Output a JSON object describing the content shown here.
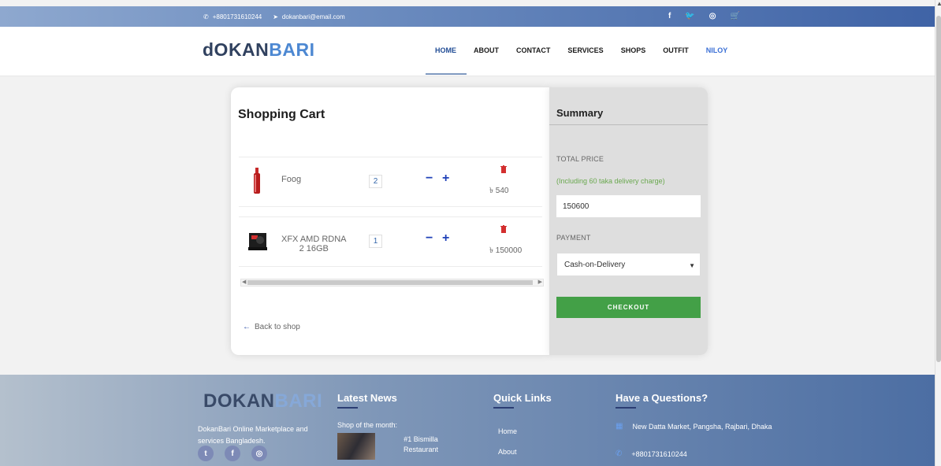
{
  "topbar": {
    "phone": "+8801731610244",
    "email": "dokanbari@email.com",
    "social_icons": [
      "facebook-icon",
      "twitter-icon",
      "instagram-icon",
      "cart-icon"
    ]
  },
  "navbar": {
    "logo_left": "dOKAN",
    "logo_right": "BARI",
    "menu": [
      "HOME",
      "ABOUT",
      "CONTACT",
      "SERVICES",
      "SHOPS",
      "OUTFIT",
      "NILOY"
    ],
    "active_menu": "HOME"
  },
  "cart": {
    "title": "Shopping Cart",
    "items": [
      {
        "name": "Foog",
        "qty": "2",
        "price": "৳ 540"
      },
      {
        "name_line1": "XFX AMD RDNA",
        "name_line2": "2 16GB",
        "qty": "1",
        "price": "৳ 150000"
      }
    ],
    "minus_label": "−",
    "plus_label": "+",
    "back_label": "Back to shop"
  },
  "summary": {
    "title": "Summary",
    "total_label": "TOTAL PRICE",
    "note": "(Including 60 taka delivery charge)",
    "total_value": "150600",
    "payment_label": "PAYMENT",
    "payment_selected": "Cash-on-Delivery",
    "checkout_label": "CHECKOUT"
  },
  "footer": {
    "logo_left": "DOKAN",
    "logo_right": "BARI",
    "desc": "DokanBari Online Marketplace and services Bangladesh.",
    "latest_news_title": "Latest News",
    "latest_news_sub": "Shop of the month:",
    "latest_news_item": "#1 Bismilla Restaurant",
    "quick_links_title": "Quick Links",
    "quick_links": [
      "Home",
      "About"
    ],
    "questions_title": "Have a Questions?",
    "address": "New Datta Market, Pangsha, Rajbari, Dhaka",
    "phone": "+8801731610244"
  },
  "colors": {
    "accent_blue": "#2041b8",
    "checkout_green": "#43a047",
    "note_green": "#6aa84f"
  }
}
